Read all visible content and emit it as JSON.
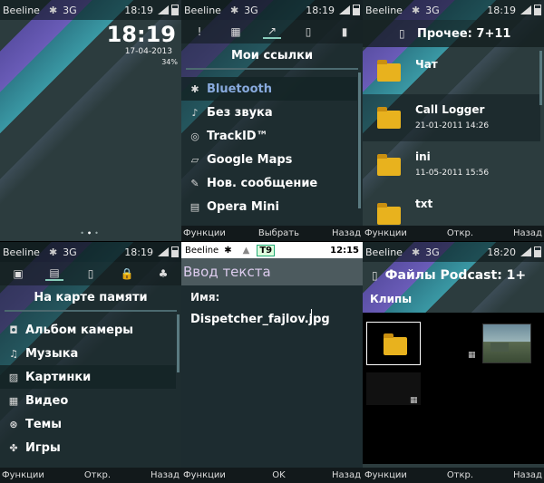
{
  "status": {
    "operator": "Beeline",
    "network": "3G"
  },
  "panels": {
    "home": {
      "time": "18:19",
      "clock": "18:19",
      "date": "17-04-2013",
      "battery_pct": "34%"
    },
    "links": {
      "time": "18:19",
      "title": "Мои ссылки",
      "tabs": [
        "!",
        "▦",
        "↗",
        "▯",
        "▮"
      ],
      "items": [
        {
          "label": "Bluetooth",
          "icon": "bluetooth-icon",
          "glyph": "✱"
        },
        {
          "label": "Без звука",
          "icon": "mute-icon",
          "glyph": "♪"
        },
        {
          "label": "TrackID™",
          "icon": "trackid-icon",
          "glyph": "◎"
        },
        {
          "label": "Google Maps",
          "icon": "maps-icon",
          "glyph": "▱"
        },
        {
          "label": "Нов. сообщение",
          "icon": "message-icon",
          "glyph": "✎"
        },
        {
          "label": "Opera Mini",
          "icon": "opera-icon",
          "glyph": "▤"
        }
      ],
      "footer": {
        "left": "Функции",
        "center": "Выбрать",
        "right": "Назад"
      }
    },
    "other": {
      "time": "18:19",
      "title": "Прочее: 7+11",
      "items": [
        {
          "name": "Чат",
          "date": ""
        },
        {
          "name": "Call Logger",
          "date": "21-01-2011 14:26"
        },
        {
          "name": "ini",
          "date": "11-05-2011 15:56"
        },
        {
          "name": "txt",
          "date": ""
        }
      ],
      "footer": {
        "left": "Функции",
        "center": "Откр.",
        "right": "Назад"
      }
    },
    "memory": {
      "time": "18:19",
      "title": "На карте памяти",
      "tabs": [
        "▣",
        "▤",
        "▯",
        "🔒",
        "♣"
      ],
      "items": [
        {
          "label": "Альбом камеры",
          "icon": "camera-icon",
          "glyph": "◘"
        },
        {
          "label": "Музыка",
          "icon": "music-icon",
          "glyph": "♫"
        },
        {
          "label": "Картинки",
          "icon": "pictures-icon",
          "glyph": "▨"
        },
        {
          "label": "Видео",
          "icon": "video-icon",
          "glyph": "▦"
        },
        {
          "label": "Темы",
          "icon": "themes-icon",
          "glyph": "⊛"
        },
        {
          "label": "Игры",
          "icon": "games-icon",
          "glyph": "✤"
        }
      ],
      "footer": {
        "left": "Функции",
        "center": "Откр.",
        "right": "Назад"
      }
    },
    "input": {
      "operator": "Beeline",
      "t9": "T9",
      "time": "12:15",
      "title": "Ввод текста",
      "label": "Имя:",
      "value": "Dispetcher_fajlov.jpg",
      "footer": {
        "left": "Функции",
        "center": "OK",
        "right": "Назад"
      }
    },
    "podcast": {
      "time": "18:20",
      "title": "Файлы Podcast: 1+",
      "subtitle": "Клипы",
      "footer": {
        "left": "Функции",
        "center": "Откр.",
        "right": "Назад"
      }
    }
  }
}
